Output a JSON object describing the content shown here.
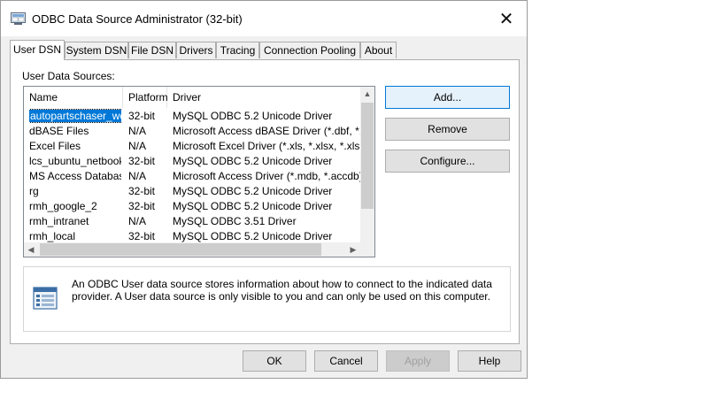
{
  "window": {
    "title": "ODBC Data Source Administrator (32-bit)",
    "close_glyph": "✕"
  },
  "tabs": [
    {
      "label": "User DSN",
      "active": true
    },
    {
      "label": "System DSN"
    },
    {
      "label": "File DSN"
    },
    {
      "label": "Drivers"
    },
    {
      "label": "Tracing"
    },
    {
      "label": "Connection Pooling"
    },
    {
      "label": "About"
    }
  ],
  "user_dsn": {
    "group_label": "User Data Sources:",
    "columns": [
      "Name",
      "Platform",
      "Driver"
    ],
    "rows": [
      {
        "name": "autopartschaser_web",
        "platform": "32-bit",
        "driver": "MySQL ODBC 5.2 Unicode Driver",
        "selected": true
      },
      {
        "name": "dBASE Files",
        "platform": "N/A",
        "driver": "Microsoft Access dBASE Driver (*.dbf, *.ndx,"
      },
      {
        "name": "Excel Files",
        "platform": "N/A",
        "driver": "Microsoft Excel Driver (*.xls, *.xlsx, *.xlsm, *.xl"
      },
      {
        "name": "lcs_ubuntu_netbook",
        "platform": "32-bit",
        "driver": "MySQL ODBC 5.2 Unicode Driver"
      },
      {
        "name": "MS Access Database",
        "platform": "N/A",
        "driver": "Microsoft Access Driver (*.mdb, *.accdb)"
      },
      {
        "name": "rg",
        "platform": "32-bit",
        "driver": "MySQL ODBC 5.2 Unicode Driver"
      },
      {
        "name": "rmh_google_2",
        "platform": "32-bit",
        "driver": "MySQL ODBC 5.2 Unicode Driver"
      },
      {
        "name": "rmh_intranet",
        "platform": "N/A",
        "driver": "MySQL ODBC 3.51 Driver"
      },
      {
        "name": "rmh_local",
        "platform": "32-bit",
        "driver": "MySQL ODBC 5.2 Unicode Driver"
      }
    ],
    "side_buttons": {
      "add": "Add...",
      "remove": "Remove",
      "configure": "Configure..."
    },
    "info_text": "An ODBC User data source stores information about how to connect to the indicated data provider.   A User data source is only visible to you and can only be used on this computer."
  },
  "footer_buttons": {
    "ok": "OK",
    "cancel": "Cancel",
    "apply": "Apply",
    "help": "Help"
  },
  "colors": {
    "selection": "#0078d7",
    "default_button_border": "#0078d7"
  }
}
